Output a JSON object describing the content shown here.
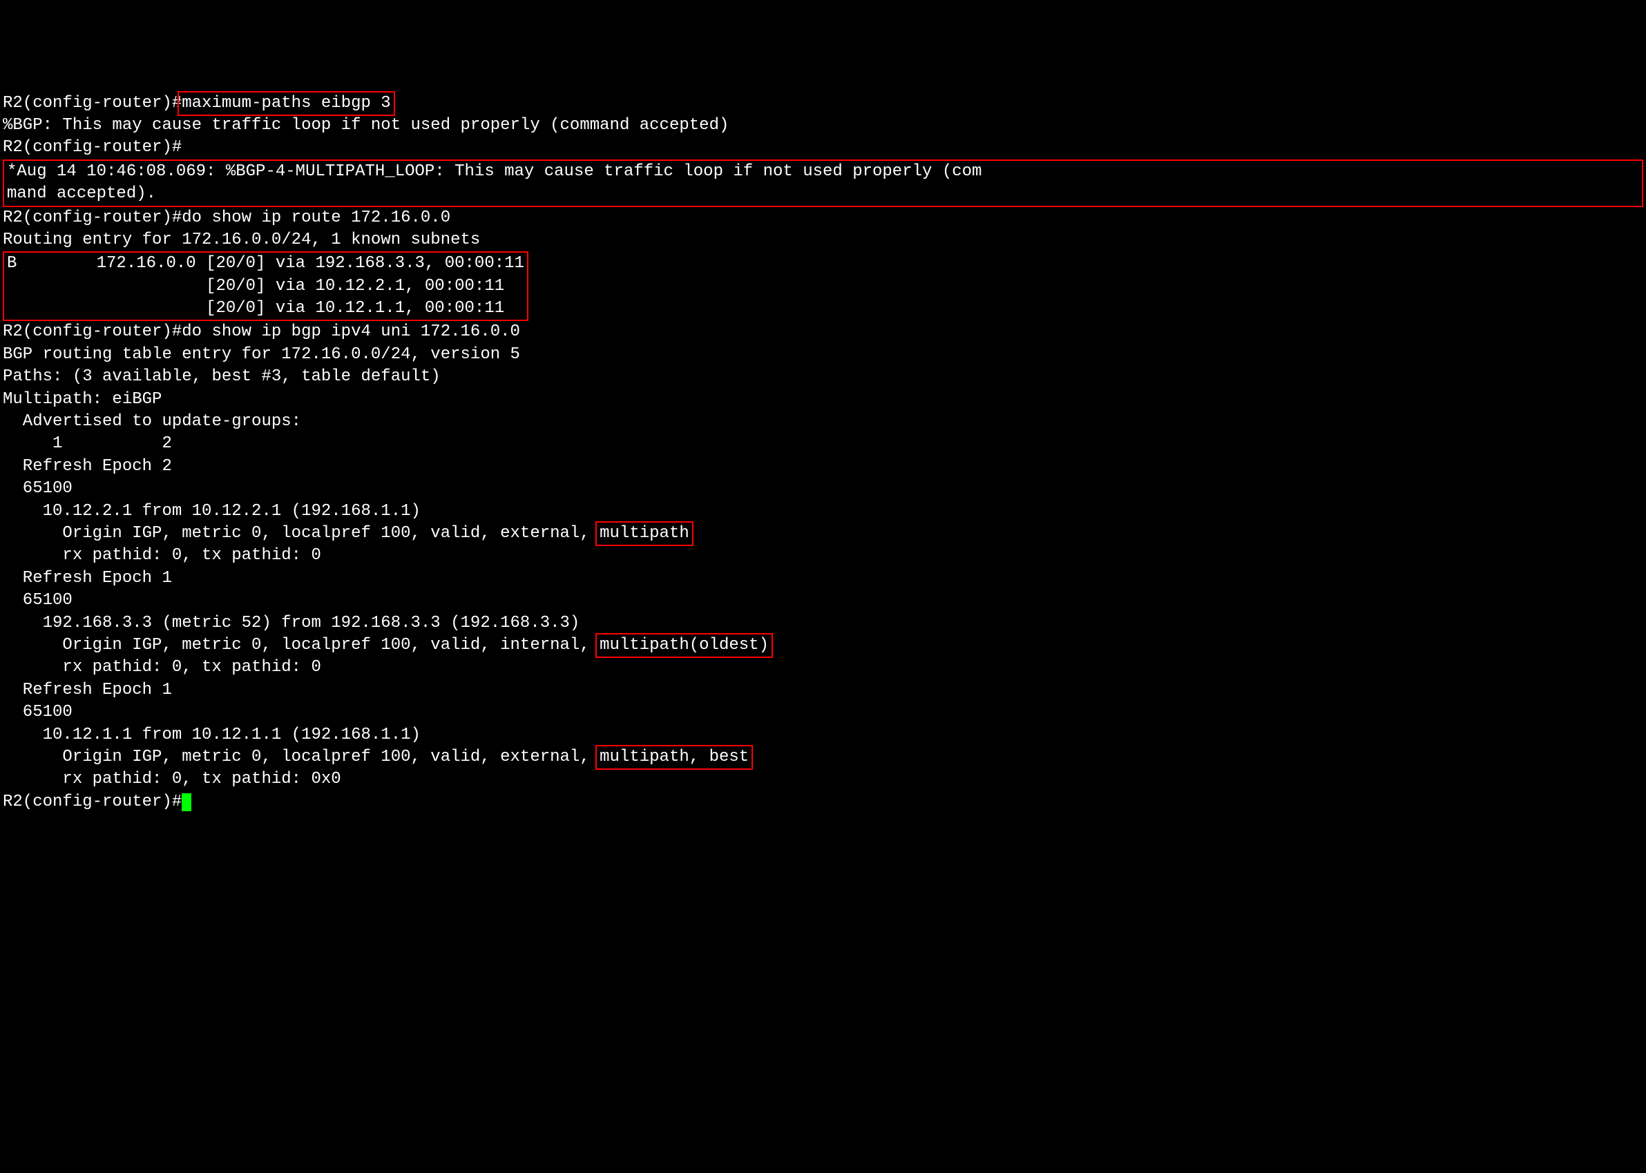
{
  "lines": {
    "l1_prompt": "R2(config-router)#",
    "l1_cmd": "maximum-paths eibgp 3",
    "l2": "%BGP: This may cause traffic loop if not used properly (command accepted)",
    "l3": "R2(config-router)#",
    "l4": "*Aug 14 10:46:08.069: %BGP-4-MULTIPATH_LOOP: This may cause traffic loop if not used properly (com",
    "l5": "mand accepted).",
    "l6": "R2(config-router)#do show ip route 172.16.0.0",
    "l7": "Routing entry for 172.16.0.0/24, 1 known subnets",
    "l8": "B        172.16.0.0 [20/0] via 192.168.3.3, 00:00:11",
    "l9": "                    [20/0] via 10.12.2.1, 00:00:11",
    "l10": "                    [20/0] via 10.12.1.1, 00:00:11",
    "l11": "R2(config-router)#do show ip bgp ipv4 uni 172.16.0.0",
    "l12": "BGP routing table entry for 172.16.0.0/24, version 5",
    "l13": "Paths: (3 available, best #3, table default)",
    "l14": "Multipath: eiBGP",
    "l15": "  Advertised to update-groups:",
    "l16": "     1          2",
    "l17": "  Refresh Epoch 2",
    "l18": "  65100",
    "l19": "    10.12.2.1 from 10.12.2.1 (192.168.1.1)",
    "l20a": "      Origin IGP, metric 0, localpref 100, valid, external, ",
    "l20b": "multipath",
    "l21": "      rx pathid: 0, tx pathid: 0",
    "l22": "  Refresh Epoch 1",
    "l23": "  65100",
    "l24": "    192.168.3.3 (metric 52) from 192.168.3.3 (192.168.3.3)",
    "l25a": "      Origin IGP, metric 0, localpref 100, valid, internal, ",
    "l25b": "multipath(oldest)",
    "l26": "      rx pathid: 0, tx pathid: 0",
    "l27": "  Refresh Epoch 1",
    "l28": "  65100",
    "l29": "    10.12.1.1 from 10.12.1.1 (192.168.1.1)",
    "l30a": "      Origin IGP, metric 0, localpref 100, valid, external, ",
    "l30b": "multipath, best",
    "l31": "      rx pathid: 0, tx pathid: 0x0",
    "l32": "R2(config-router)#"
  }
}
